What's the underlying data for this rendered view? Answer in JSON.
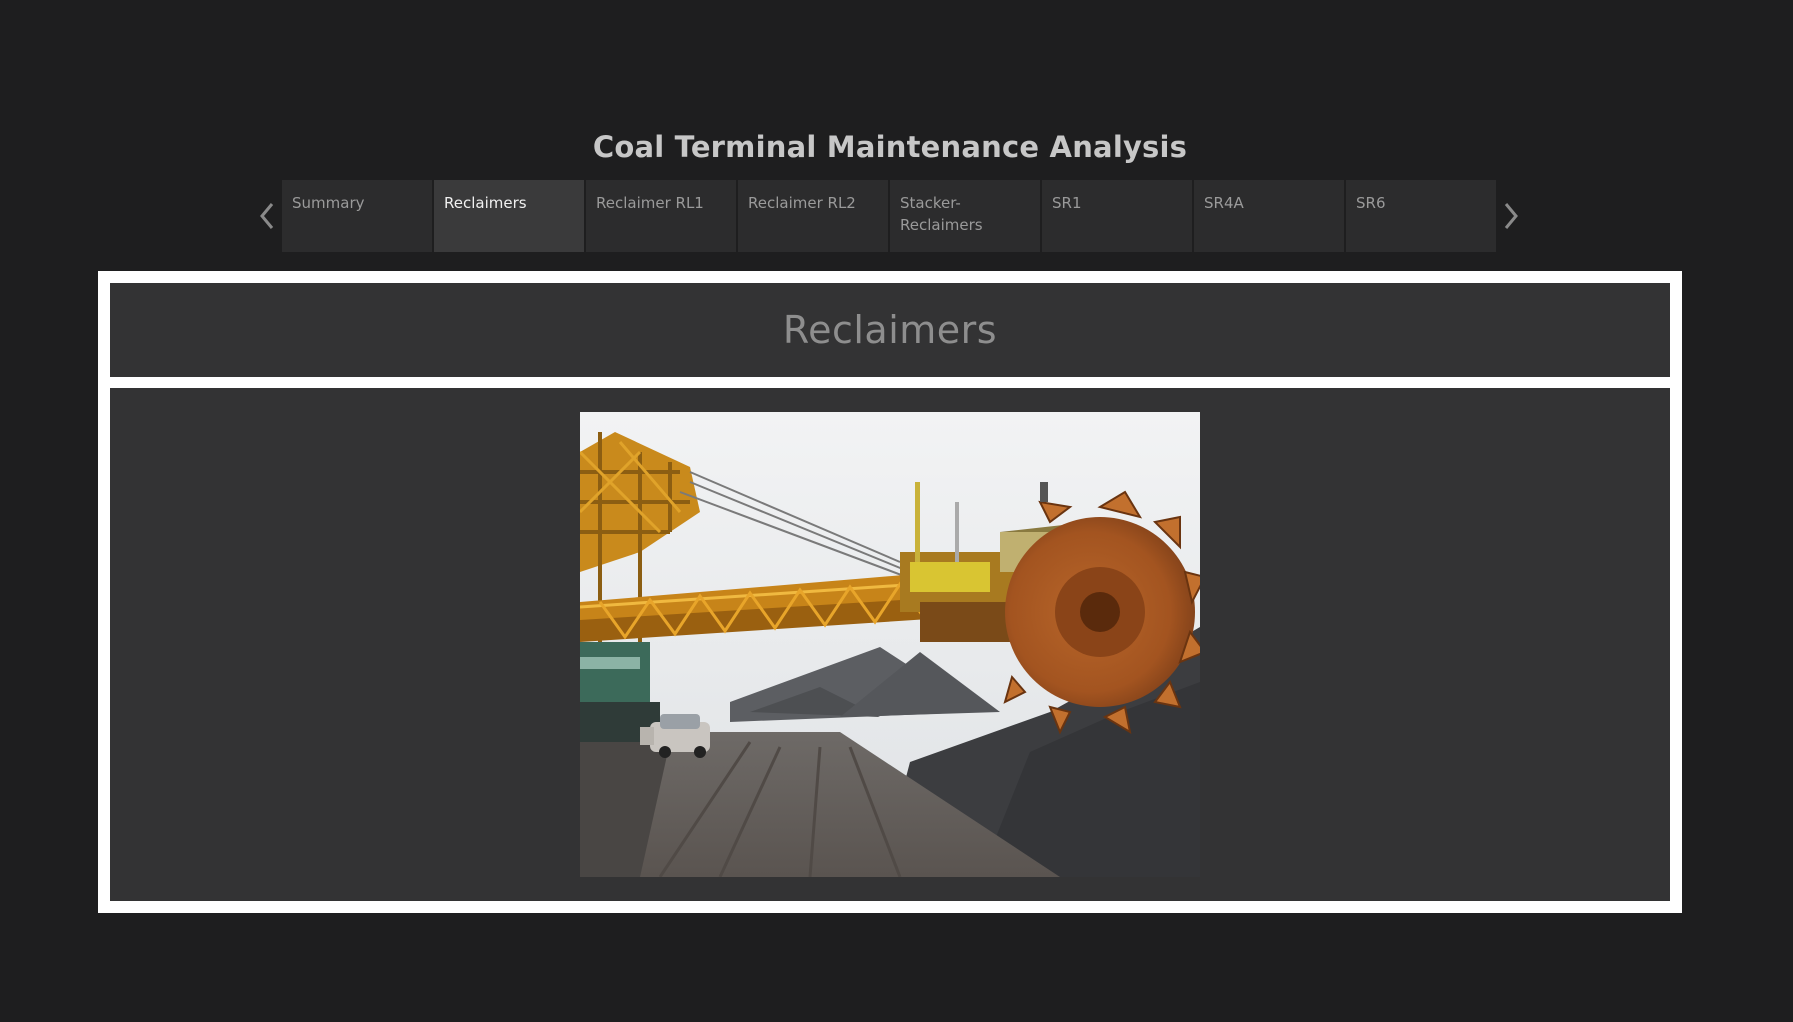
{
  "app": {
    "title": "Coal Terminal Maintenance Analysis"
  },
  "nav": {
    "prev_icon": "chevron-left-icon",
    "next_icon": "chevron-right-icon",
    "tabs": [
      {
        "label": "Summary",
        "active": false
      },
      {
        "label": "Reclaimers",
        "active": true
      },
      {
        "label": "Reclaimer RL1",
        "active": false
      },
      {
        "label": "Reclaimer RL2",
        "active": false
      },
      {
        "label": "Stacker-\nReclaimers",
        "active": false
      },
      {
        "label": "SR1",
        "active": false
      },
      {
        "label": "SR4A",
        "active": false
      },
      {
        "label": "SR6",
        "active": false
      }
    ]
  },
  "dashboard": {
    "heading": "Reclaimers"
  },
  "colors": {
    "background": "#1e1e1f",
    "panel": "#333334",
    "frame": "#ffffff",
    "tab": "#2c2c2d",
    "tab_active": "#3a3a3b",
    "title_text": "#c7c7c7",
    "heading_text": "#8e8e8e"
  }
}
